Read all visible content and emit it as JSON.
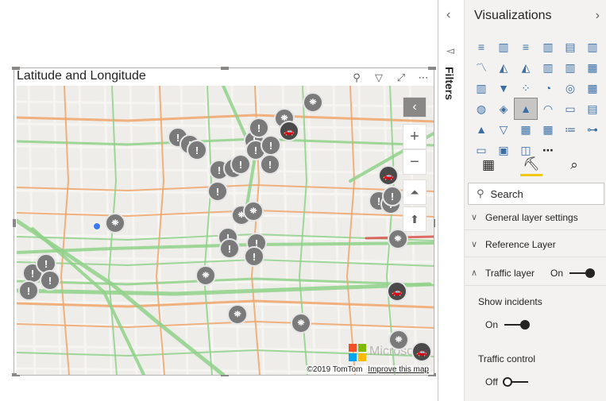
{
  "visual": {
    "title": "Latitude and Longitude",
    "tools": [
      {
        "icon": "pin-icon",
        "glyph": "⚲"
      },
      {
        "icon": "filter-icon",
        "glyph": "▽"
      },
      {
        "icon": "focus-mode-icon",
        "glyph": "⤢"
      },
      {
        "icon": "more-options-icon",
        "glyph": "⋯"
      }
    ]
  },
  "map": {
    "attribution": "©2019 TomTom",
    "improve_link": "Improve this map",
    "watermark": "Microsoft",
    "controls": {
      "collapse_glyph": "‹",
      "zoom_in": "+",
      "zoom_out": "−",
      "pitch_glyph": "⏶",
      "compass_glyph": "⬆"
    },
    "road_colors": {
      "free_flow": "#8fd18a",
      "slow": "#f0a56a",
      "stopped": "#d9534f"
    },
    "incident_glyph": "!",
    "construction_glyph": "⛯",
    "car_glyph": "🚗"
  },
  "filters": {
    "label": "Filters",
    "collapse_glyph": "‹"
  },
  "pane": {
    "title": "Visualizations",
    "expand_glyph": "›",
    "visual_icons": [
      "stacked-bar-icon",
      "stacked-column-icon",
      "clustered-bar-icon",
      "clustered-column-icon",
      "100-bar-icon",
      "100-column-icon",
      "line-icon",
      "area-icon",
      "stacked-area-icon",
      "line-column-icon",
      "line-clustered-icon",
      "ribbon-icon",
      "waterfall-icon",
      "funnel-icon",
      "scatter-icon",
      "pie-icon",
      "donut-icon",
      "treemap-icon",
      "map-icon",
      "filled-map-icon",
      "azure-map-icon",
      "gauge-icon",
      "card-icon",
      "multirow-card-icon",
      "kpi-icon",
      "slicer-icon",
      "table-icon",
      "matrix-icon",
      "r-visual-icon",
      "decomposition-icon",
      "qna-icon",
      "key-influencers-icon",
      "shape-map-icon",
      "more-icon"
    ],
    "visual_glyphs": [
      "≡",
      "▥",
      "≡",
      "▥",
      "▤",
      "▥",
      "〽",
      "◭",
      "◭",
      "▥",
      "▥",
      "▦",
      "▥",
      "▼",
      "⁘",
      "◔",
      "◎",
      "▦",
      "◍",
      "◈",
      "▲",
      "◠",
      "▭",
      "▤",
      "▲",
      "▽",
      "▦",
      "▦",
      "≔",
      "⊶",
      "▭",
      "▣",
      "◫",
      "⋯"
    ],
    "selected_visual_index": 20,
    "tabs": [
      {
        "icon": "fields-icon",
        "glyph": "▦"
      },
      {
        "icon": "format-paint-icon",
        "glyph": "⛏"
      },
      {
        "icon": "analytics-icon",
        "glyph": "⌕"
      }
    ],
    "search_placeholder": "Search",
    "sections": [
      {
        "label": "General layer settings",
        "expanded": false
      },
      {
        "label": "Reference Layer",
        "expanded": false
      },
      {
        "label": "Traffic layer",
        "expanded": true,
        "toggle": "On"
      }
    ],
    "show_incidents": {
      "label": "Show incidents",
      "value": "On"
    },
    "traffic_control": {
      "label": "Traffic control",
      "value": "Off"
    }
  }
}
